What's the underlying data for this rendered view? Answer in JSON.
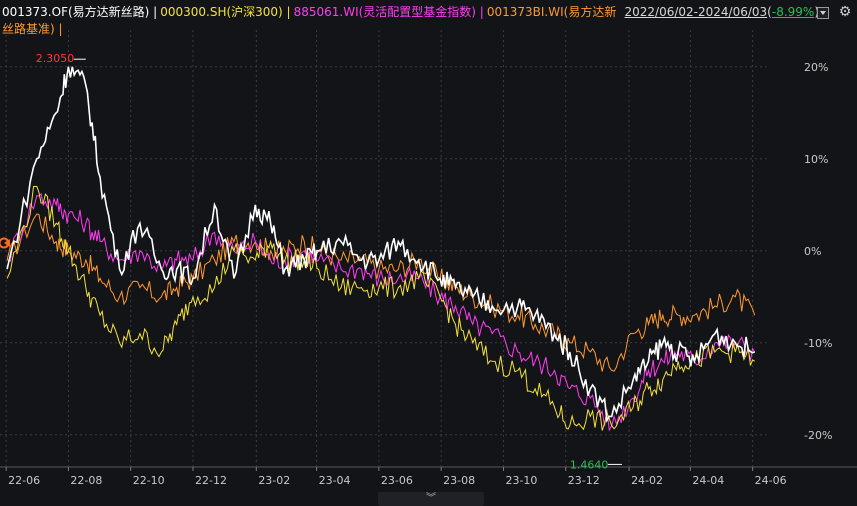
{
  "legend": {
    "items": [
      {
        "text": "001373.OF(易方达新丝路)",
        "color": "#ffffff"
      },
      {
        "text": "000300.SH(沪深300)",
        "color": "#f4e23a"
      },
      {
        "text": "885061.WI(灵活配置型基金指数)",
        "color": "#ff3df2"
      },
      {
        "text": "001373BI.WI(易方达新丝路基准)",
        "color": "#ff9a2e"
      }
    ],
    "separator": "|"
  },
  "range": {
    "dates": "2022/06/02-2024/06/03",
    "change": "-8.99%"
  },
  "colors": {
    "background": "#131418",
    "grid": "#3b3d44",
    "axis_text": "#c9c9c9",
    "max_label": "#ff3b30",
    "min_label": "#2dbd4f"
  },
  "chart_data": {
    "type": "line",
    "x": [
      "2022-06-02",
      "2022-07-01",
      "2022-07-20",
      "2022-08-01",
      "2022-08-18",
      "2022-09-01",
      "2022-09-20",
      "2022-10-10",
      "2022-10-31",
      "2022-11-15",
      "2022-12-01",
      "2022-12-22",
      "2023-01-10",
      "2023-01-31",
      "2023-02-15",
      "2023-03-01",
      "2023-03-20",
      "2023-04-03",
      "2023-04-25",
      "2023-05-15",
      "2023-06-01",
      "2023-06-20",
      "2023-07-10",
      "2023-07-31",
      "2023-08-15",
      "2023-09-01",
      "2023-09-20",
      "2023-10-15",
      "2023-11-01",
      "2023-11-20",
      "2023-12-05",
      "2023-12-25",
      "2024-01-15",
      "2024-02-05",
      "2024-02-20",
      "2024-03-05",
      "2024-03-20",
      "2024-04-05",
      "2024-04-25",
      "2024-05-15",
      "2024-06-03"
    ],
    "series": [
      {
        "name": "001373.OF(易方达新丝路)",
        "color": "#ffffff",
        "values": [
          -2,
          10,
          15,
          20,
          18,
          8,
          -2,
          3,
          -2,
          -2,
          -3,
          5,
          -3,
          5,
          3,
          -2,
          -1,
          0,
          1,
          -1,
          -1,
          1,
          -1,
          -3,
          -4,
          -5,
          -6,
          -6,
          -7,
          -9,
          -11,
          -15,
          -18,
          -14,
          -12,
          -10,
          -11,
          -12,
          -9,
          -10,
          -11
        ]
      },
      {
        "name": "000300.SH(沪深300)",
        "color": "#f4e23a",
        "values": [
          -3,
          7,
          3,
          0,
          -4,
          -7,
          -10,
          -9,
          -11,
          -8,
          -5,
          -4,
          0,
          -1,
          1,
          -1,
          -1,
          -2,
          -4,
          -4,
          -4,
          -4,
          -3,
          -5,
          -8,
          -10,
          -12,
          -13,
          -15,
          -17,
          -19,
          -18,
          -19,
          -17,
          -15,
          -14,
          -12,
          -12,
          -11,
          -11,
          -12
        ]
      },
      {
        "name": "885061.WI(灵活配置型基金指数)",
        "color": "#ff3df2",
        "values": [
          -1,
          6,
          5,
          4,
          3,
          1,
          -1,
          0,
          -2,
          -1,
          -1,
          2,
          0,
          1,
          -1,
          -1,
          0,
          -1,
          -2,
          -2,
          -3,
          -3,
          -3,
          -5,
          -6,
          -8,
          -9,
          -11,
          -12,
          -13,
          -15,
          -16,
          -19,
          -16,
          -13,
          -12,
          -11,
          -12,
          -10,
          -10,
          -11
        ]
      },
      {
        "name": "001373BI.WI(易方达新丝路基准)",
        "color": "#ff9a2e",
        "values": [
          -1,
          4,
          1,
          0,
          -1,
          -3,
          -5,
          -4,
          -5,
          -4,
          -3,
          -1,
          1,
          1,
          0,
          0,
          1,
          0,
          -1,
          -1,
          -2,
          -2,
          -1,
          -3,
          -4,
          -5,
          -6,
          -7,
          -8,
          -9,
          -10,
          -11,
          -13,
          -9,
          -8,
          -7,
          -7,
          -7,
          -6,
          -5,
          -7
        ]
      }
    ],
    "y_ticks": [
      "20%",
      "10%",
      "0%",
      "-10%",
      "-20%"
    ],
    "y_tick_values": [
      20,
      10,
      0,
      -10,
      -20
    ],
    "ylim": [
      -23.5,
      24
    ],
    "x_ticks": [
      "22-06",
      "22-08",
      "22-10",
      "22-12",
      "23-02",
      "23-04",
      "23-06",
      "23-08",
      "23-10",
      "23-12",
      "24-02",
      "24-04",
      "24-06"
    ],
    "x_tick_dates": [
      "2022-06-01",
      "2022-08-01",
      "2022-10-01",
      "2022-12-01",
      "2023-02-01",
      "2023-04-01",
      "2023-06-01",
      "2023-08-01",
      "2023-10-01",
      "2023-12-01",
      "2024-02-01",
      "2024-04-01",
      "2024-06-01"
    ],
    "xlim": [
      "2022-05-26",
      "2024-06-18"
    ],
    "annotations": [
      {
        "text": "2.3050",
        "date": "2022-08-18",
        "value": 20.5,
        "color": "#ff3b30",
        "role": "max"
      },
      {
        "text": "1.4640",
        "date": "2024-01-25",
        "value": -23,
        "color": "#2dbd4f",
        "role": "min"
      }
    ],
    "grid": true,
    "legend": "top-left"
  },
  "scroll": {
    "glyph": "︾"
  }
}
